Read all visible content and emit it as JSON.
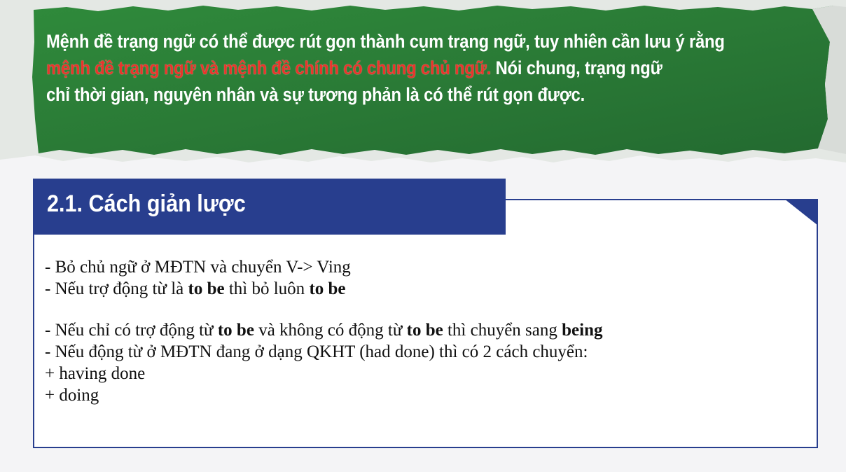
{
  "banner": {
    "line1": "Mệnh đề trạng ngữ có thể được rút gọn thành cụm trạng ngữ, tuy nhiên cần lưu ý rằng",
    "highlight": "mệnh đề trạng ngữ và mệnh đề chính có chung chủ ngữ.",
    "line2_rest": " Nói chung, trạng ngữ",
    "line3": "chỉ thời gian, nguyên nhân và sự tương phản là có thể rút gọn được."
  },
  "section": {
    "title": "2.1. Cách giản lược",
    "lines": {
      "l1": "- Bỏ chủ ngữ ở MĐTN và chuyển V-> Ving",
      "l2_a": "- Nếu trợ động từ là ",
      "l2_b": "to be",
      "l2_c": " thì bỏ luôn ",
      "l2_d": "to be",
      "l3_a": "- Nếu chỉ có trợ động từ ",
      "l3_b": "to be",
      "l3_c": " và không có động từ ",
      "l3_d": "to be",
      "l3_e": " thì chuyển sang ",
      "l3_f": "being",
      "l4": "- Nếu động từ ở MĐTN đang ở dạng QKHT (had done) thì có 2 cách chuyển:",
      "l5": "+ having done",
      "l6": "+ doing"
    }
  },
  "colors": {
    "banner_green": "#2e7d3a",
    "highlight_red": "#e8352c",
    "section_blue": "#283e8e"
  }
}
